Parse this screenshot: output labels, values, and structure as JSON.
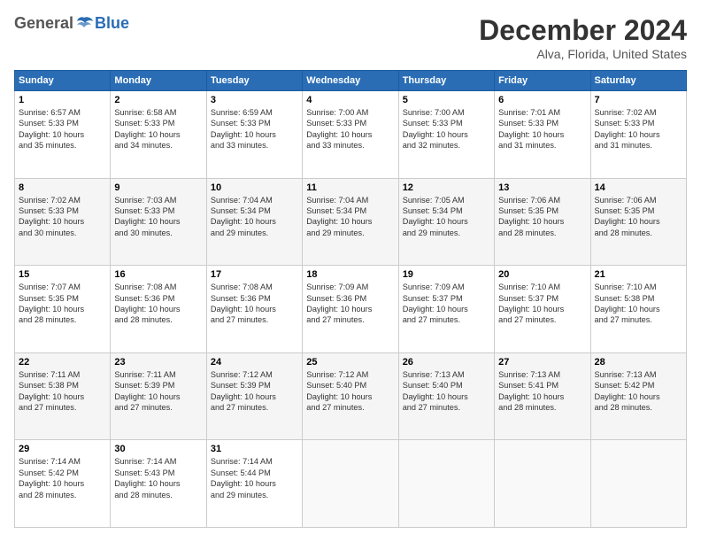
{
  "logo": {
    "general": "General",
    "blue": "Blue"
  },
  "title": "December 2024",
  "location": "Alva, Florida, United States",
  "days_of_week": [
    "Sunday",
    "Monday",
    "Tuesday",
    "Wednesday",
    "Thursday",
    "Friday",
    "Saturday"
  ],
  "weeks": [
    [
      {
        "day": "1",
        "sunrise": "6:57 AM",
        "sunset": "5:33 PM",
        "daylight": "10 hours and 35 minutes."
      },
      {
        "day": "2",
        "sunrise": "6:58 AM",
        "sunset": "5:33 PM",
        "daylight": "10 hours and 34 minutes."
      },
      {
        "day": "3",
        "sunrise": "6:59 AM",
        "sunset": "5:33 PM",
        "daylight": "10 hours and 33 minutes."
      },
      {
        "day": "4",
        "sunrise": "7:00 AM",
        "sunset": "5:33 PM",
        "daylight": "10 hours and 33 minutes."
      },
      {
        "day": "5",
        "sunrise": "7:00 AM",
        "sunset": "5:33 PM",
        "daylight": "10 hours and 32 minutes."
      },
      {
        "day": "6",
        "sunrise": "7:01 AM",
        "sunset": "5:33 PM",
        "daylight": "10 hours and 31 minutes."
      },
      {
        "day": "7",
        "sunrise": "7:02 AM",
        "sunset": "5:33 PM",
        "daylight": "10 hours and 31 minutes."
      }
    ],
    [
      {
        "day": "8",
        "sunrise": "7:02 AM",
        "sunset": "5:33 PM",
        "daylight": "10 hours and 30 minutes."
      },
      {
        "day": "9",
        "sunrise": "7:03 AM",
        "sunset": "5:33 PM",
        "daylight": "10 hours and 30 minutes."
      },
      {
        "day": "10",
        "sunrise": "7:04 AM",
        "sunset": "5:34 PM",
        "daylight": "10 hours and 29 minutes."
      },
      {
        "day": "11",
        "sunrise": "7:04 AM",
        "sunset": "5:34 PM",
        "daylight": "10 hours and 29 minutes."
      },
      {
        "day": "12",
        "sunrise": "7:05 AM",
        "sunset": "5:34 PM",
        "daylight": "10 hours and 29 minutes."
      },
      {
        "day": "13",
        "sunrise": "7:06 AM",
        "sunset": "5:35 PM",
        "daylight": "10 hours and 28 minutes."
      },
      {
        "day": "14",
        "sunrise": "7:06 AM",
        "sunset": "5:35 PM",
        "daylight": "10 hours and 28 minutes."
      }
    ],
    [
      {
        "day": "15",
        "sunrise": "7:07 AM",
        "sunset": "5:35 PM",
        "daylight": "10 hours and 28 minutes."
      },
      {
        "day": "16",
        "sunrise": "7:08 AM",
        "sunset": "5:36 PM",
        "daylight": "10 hours and 28 minutes."
      },
      {
        "day": "17",
        "sunrise": "7:08 AM",
        "sunset": "5:36 PM",
        "daylight": "10 hours and 27 minutes."
      },
      {
        "day": "18",
        "sunrise": "7:09 AM",
        "sunset": "5:36 PM",
        "daylight": "10 hours and 27 minutes."
      },
      {
        "day": "19",
        "sunrise": "7:09 AM",
        "sunset": "5:37 PM",
        "daylight": "10 hours and 27 minutes."
      },
      {
        "day": "20",
        "sunrise": "7:10 AM",
        "sunset": "5:37 PM",
        "daylight": "10 hours and 27 minutes."
      },
      {
        "day": "21",
        "sunrise": "7:10 AM",
        "sunset": "5:38 PM",
        "daylight": "10 hours and 27 minutes."
      }
    ],
    [
      {
        "day": "22",
        "sunrise": "7:11 AM",
        "sunset": "5:38 PM",
        "daylight": "10 hours and 27 minutes."
      },
      {
        "day": "23",
        "sunrise": "7:11 AM",
        "sunset": "5:39 PM",
        "daylight": "10 hours and 27 minutes."
      },
      {
        "day": "24",
        "sunrise": "7:12 AM",
        "sunset": "5:39 PM",
        "daylight": "10 hours and 27 minutes."
      },
      {
        "day": "25",
        "sunrise": "7:12 AM",
        "sunset": "5:40 PM",
        "daylight": "10 hours and 27 minutes."
      },
      {
        "day": "26",
        "sunrise": "7:13 AM",
        "sunset": "5:40 PM",
        "daylight": "10 hours and 27 minutes."
      },
      {
        "day": "27",
        "sunrise": "7:13 AM",
        "sunset": "5:41 PM",
        "daylight": "10 hours and 28 minutes."
      },
      {
        "day": "28",
        "sunrise": "7:13 AM",
        "sunset": "5:42 PM",
        "daylight": "10 hours and 28 minutes."
      }
    ],
    [
      {
        "day": "29",
        "sunrise": "7:14 AM",
        "sunset": "5:42 PM",
        "daylight": "10 hours and 28 minutes."
      },
      {
        "day": "30",
        "sunrise": "7:14 AM",
        "sunset": "5:43 PM",
        "daylight": "10 hours and 28 minutes."
      },
      {
        "day": "31",
        "sunrise": "7:14 AM",
        "sunset": "5:44 PM",
        "daylight": "10 hours and 29 minutes."
      },
      null,
      null,
      null,
      null
    ]
  ],
  "labels": {
    "sunrise": "Sunrise:",
    "sunset": "Sunset:",
    "daylight": "Daylight:"
  }
}
